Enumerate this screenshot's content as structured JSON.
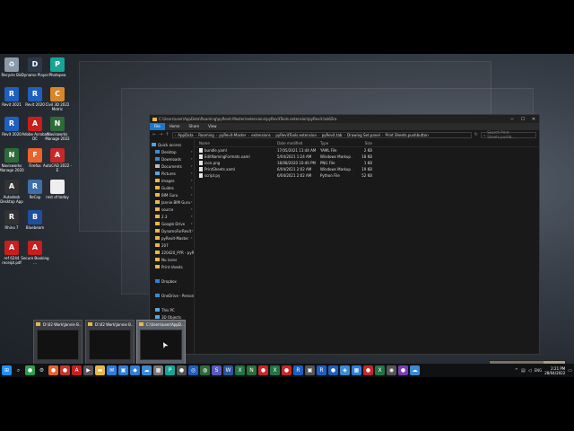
{
  "desktop_icons": [
    {
      "label": "Recycle Bin",
      "icon": "recycle-bin-icon",
      "color": "#8a9aa8",
      "glyph": "♻"
    },
    {
      "label": "Dynamo Player",
      "icon": "dynamo-icon",
      "color": "#2b3a4a",
      "glyph": "D"
    },
    {
      "label": "Photopea",
      "icon": "photopea-icon",
      "color": "#18a497",
      "glyph": "P"
    },
    {
      "label": "Revit 2021",
      "icon": "revit-icon",
      "color": "#1f5fbf",
      "glyph": "R"
    },
    {
      "label": "Revit 2020",
      "icon": "revit-icon",
      "color": "#1f5fbf",
      "glyph": "R"
    },
    {
      "label": "Civil 3D 2022 Metric",
      "icon": "civil3d-icon",
      "color": "#d7862a",
      "glyph": "C"
    },
    {
      "label": "Revit 2020",
      "icon": "revit-icon",
      "color": "#1f5fbf",
      "glyph": "R"
    },
    {
      "label": "Adobe Acrobat DC",
      "icon": "acrobat-icon",
      "color": "#c81e1e",
      "glyph": "A"
    },
    {
      "label": "Navisworks Manage 2022",
      "icon": "navisworks-icon",
      "color": "#2e6b3a",
      "glyph": "N"
    },
    {
      "label": "Navisworks Manage 2020",
      "icon": "navisworks-icon",
      "color": "#2e6b3a",
      "glyph": "N"
    },
    {
      "label": "Firefox",
      "icon": "firefox-icon",
      "color": "#e8642a",
      "glyph": "F"
    },
    {
      "label": "AutoCAD 2022 - E",
      "icon": "autocad-icon",
      "color": "#c62828",
      "glyph": "A"
    },
    {
      "label": "Autodesk Desktop App",
      "icon": "autodesk-icon",
      "color": "#333",
      "glyph": "A"
    },
    {
      "label": "ReCap",
      "icon": "recap-icon",
      "color": "#3d6fa8",
      "glyph": "R"
    },
    {
      "label": "rest of today",
      "icon": "document-icon",
      "color": "#eee",
      "glyph": ""
    },
    {
      "label": "Rhino 7",
      "icon": "rhino-icon",
      "color": "#333",
      "glyph": "R"
    },
    {
      "label": "Bluebeam",
      "icon": "bluebeam-icon",
      "color": "#1d4f9c",
      "glyph": "B"
    },
    {
      "label": "ref 6244 receipt.pdf",
      "icon": "pdf-icon",
      "color": "#c81e1e",
      "glyph": "A"
    },
    {
      "label": "Secure Booking ...",
      "icon": "pdf-icon",
      "color": "#c81e1e",
      "glyph": "A"
    }
  ],
  "explorer": {
    "title_path": "C:\\Users\\user\\AppData\\Roaming\\pyRevit-Master\\extensions\\pyRevitTools.extension\\pyRevit.tab\\Dra",
    "ribbon_tabs": [
      "File",
      "Home",
      "Share",
      "View"
    ],
    "breadcrumbs": [
      "AppData",
      "Roaming",
      "pyRevit-Master",
      "extensions",
      "pyRevitTools.extension",
      "pyRevit.tab",
      "Drawing Set.panel",
      "Print Sheets.pushbutton"
    ],
    "search_placeholder": "Search Print Sheets.pushb...",
    "nav_items": [
      {
        "label": "Quick access",
        "icon": "star-icon",
        "color": "#4aa3e8",
        "pinned": false
      },
      {
        "label": "Desktop",
        "icon": "folder-icon",
        "color": "#3a8ad6",
        "pinned": true
      },
      {
        "label": "Downloads",
        "icon": "download-icon",
        "color": "#3a8ad6",
        "pinned": true
      },
      {
        "label": "Documents",
        "icon": "folder-icon",
        "color": "#bcbcbc",
        "pinned": true
      },
      {
        "label": "Pictures",
        "icon": "folder-icon",
        "color": "#5aa6e0",
        "pinned": true
      },
      {
        "label": "Images",
        "icon": "folder-icon",
        "color": "#e8b64a",
        "pinned": true
      },
      {
        "label": "Guides",
        "icon": "folder-icon",
        "color": "#e8b64a",
        "pinned": true
      },
      {
        "label": "BIM Guru",
        "icon": "folder-icon",
        "color": "#e8b64a",
        "pinned": true
      },
      {
        "label": "Jannie BIM Guru",
        "icon": "folder-icon",
        "color": "#e8b64a",
        "pinned": true
      },
      {
        "label": "source",
        "icon": "folder-icon",
        "color": "#e8b64a",
        "pinned": true
      },
      {
        "label": "2.3",
        "icon": "folder-icon",
        "color": "#e8b64a",
        "pinned": true
      },
      {
        "label": "Google Drive",
        "icon": "folder-icon",
        "color": "#e8b64a",
        "pinned": true
      },
      {
        "label": "DynamoForRevit",
        "icon": "folder-icon",
        "color": "#e8b64a",
        "pinned": true
      },
      {
        "label": "pyRevit-Master",
        "icon": "folder-icon",
        "color": "#e8b64a",
        "pinned": true
      },
      {
        "label": "207",
        "icon": "folder-icon",
        "color": "#e8b64a",
        "pinned": false
      },
      {
        "label": "220420_PYR - pyRe",
        "icon": "folder-icon",
        "color": "#e8b64a",
        "pinned": false
      },
      {
        "label": "Nu icons",
        "icon": "folder-icon",
        "color": "#e8b64a",
        "pinned": false
      },
      {
        "label": "Print sheets",
        "icon": "folder-icon",
        "color": "#e8b64a",
        "pinned": false
      },
      {
        "label": "",
        "icon": "blank",
        "color": "transparent",
        "pinned": false
      },
      {
        "label": "Dropbox",
        "icon": "dropbox-icon",
        "color": "#2f7ed8",
        "pinned": false
      },
      {
        "label": "",
        "icon": "blank",
        "color": "transparent",
        "pinned": false
      },
      {
        "label": "OneDrive - Personal",
        "icon": "onedrive-icon",
        "color": "#3a8ad6",
        "pinned": false
      },
      {
        "label": "",
        "icon": "blank",
        "color": "transparent",
        "pinned": false
      },
      {
        "label": "This PC",
        "icon": "computer-icon",
        "color": "#5aa6e0",
        "pinned": false
      },
      {
        "label": "3D Objects",
        "icon": "folder-icon",
        "color": "#5aa6e0",
        "pinned": false
      },
      {
        "label": "Desktop",
        "icon": "folder-icon",
        "color": "#3a8ad6",
        "pinned": false
      }
    ],
    "columns": [
      "Name",
      "Date modified",
      "Type",
      "Size"
    ],
    "files": [
      {
        "name": "bundle.yaml",
        "date": "17/05/2021 11:44 AM",
        "type": "YAML File",
        "size": "2 KB"
      },
      {
        "name": "EditNamingFormats.xaml",
        "date": "5/04/2021 1:24 AM",
        "type": "Windows Markup ...",
        "size": "18 KB"
      },
      {
        "name": "icon.png",
        "date": "18/08/2020 10:40 PM",
        "type": "PNG File",
        "size": "1 KB"
      },
      {
        "name": "PrintSheets.xaml",
        "date": "6/04/2021 2:02 AM",
        "type": "Windows Markup ...",
        "size": "19 KB"
      },
      {
        "name": "script.py",
        "date": "6/04/2021 2:02 AM",
        "type": "Python File",
        "size": "52 KB"
      }
    ]
  },
  "thumbnails": [
    {
      "title": "D:\\02 Work\\Jannie B..."
    },
    {
      "title": "D:\\02 Work\\Jannie B..."
    },
    {
      "title": "C:\\Users\\user\\AppD..."
    }
  ],
  "taskbar": {
    "icons": [
      {
        "name": "start-icon",
        "color": "#1e90ff",
        "glyph": "⊞"
      },
      {
        "name": "search-icon",
        "color": "transparent",
        "glyph": "⌕"
      },
      {
        "name": "chrome-icon",
        "color": "#2e9e4a",
        "glyph": "●"
      },
      {
        "name": "settings-icon",
        "color": "transparent",
        "glyph": "⚙"
      },
      {
        "name": "firefox-icon",
        "color": "#e8642a",
        "glyph": "●"
      },
      {
        "name": "app-icon",
        "color": "#c0392b",
        "glyph": "●"
      },
      {
        "name": "acrobat-icon",
        "color": "#c81e1e",
        "glyph": "A"
      },
      {
        "name": "media-icon",
        "color": "#555",
        "glyph": "▶"
      },
      {
        "name": "file-explorer-icon",
        "color": "#e8b64a",
        "glyph": "▬"
      },
      {
        "name": "mail-icon",
        "color": "#2f7ed8",
        "glyph": "✉"
      },
      {
        "name": "app-icon",
        "color": "#2f7ed8",
        "glyph": "▣"
      },
      {
        "name": "app-icon",
        "color": "#2f7ed8",
        "glyph": "◆"
      },
      {
        "name": "app-icon",
        "color": "#3a8ad6",
        "glyph": "☁"
      },
      {
        "name": "app-icon",
        "color": "#777",
        "glyph": "▦"
      },
      {
        "name": "app-icon",
        "color": "#18a497",
        "glyph": "P"
      },
      {
        "name": "app-icon",
        "color": "#555",
        "glyph": "●"
      },
      {
        "name": "app-icon",
        "color": "#1f5fbf",
        "glyph": "◎"
      },
      {
        "name": "app-icon",
        "color": "#2e6b3a",
        "glyph": "◍"
      },
      {
        "name": "app-icon",
        "color": "#5a5ab8",
        "glyph": "S"
      },
      {
        "name": "word-icon",
        "color": "#2b579a",
        "glyph": "W"
      },
      {
        "name": "excel-icon",
        "color": "#217346",
        "glyph": "X"
      },
      {
        "name": "app-icon",
        "color": "#2e6b3a",
        "glyph": "N"
      },
      {
        "name": "app-icon",
        "color": "#c62828",
        "glyph": "●"
      },
      {
        "name": "app-icon",
        "color": "#217346",
        "glyph": "X"
      },
      {
        "name": "app-icon",
        "color": "#c62828",
        "glyph": "●"
      },
      {
        "name": "app-icon",
        "color": "#1f5fbf",
        "glyph": "R"
      },
      {
        "name": "app-icon",
        "color": "#555",
        "glyph": "▣"
      },
      {
        "name": "app-icon",
        "color": "#1f5fbf",
        "glyph": "R"
      },
      {
        "name": "app-icon",
        "color": "#1f5fbf",
        "glyph": "●"
      },
      {
        "name": "app-icon",
        "color": "#3a8ad6",
        "glyph": "◈"
      },
      {
        "name": "app-icon",
        "color": "#2f7ed8",
        "glyph": "▦"
      },
      {
        "name": "app-icon",
        "color": "#c62828",
        "glyph": "●"
      },
      {
        "name": "app-icon",
        "color": "#217346",
        "glyph": "X"
      },
      {
        "name": "app-icon",
        "color": "#555",
        "glyph": "◉"
      },
      {
        "name": "app-icon",
        "color": "#7a3fb8",
        "glyph": "●"
      },
      {
        "name": "app-icon",
        "color": "#3a8ad6",
        "glyph": "☁"
      }
    ],
    "language": "ENG",
    "time": "2:21 PM",
    "date": "28/04/2022"
  }
}
